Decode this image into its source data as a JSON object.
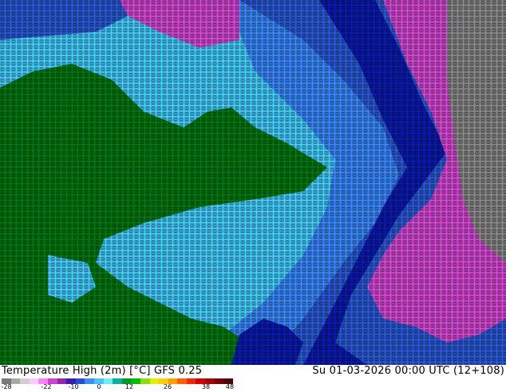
{
  "title": "Temperature High (2m) [°C] GFS 0.25",
  "datetime": "Su 01-03-2026 00:00 UTC (12+108)",
  "colorbar": {
    "colors": [
      "#7a7a7a",
      "#a8a8a8",
      "#d0d0d0",
      "#ffc6ff",
      "#ff80ff",
      "#d040d0",
      "#9a20b0",
      "#3a1ab8",
      "#2a4ad8",
      "#3a8aff",
      "#46c4ff",
      "#6af0f0",
      "#00b4a0",
      "#009a28",
      "#00c000",
      "#8ae000",
      "#e4f000",
      "#ffd000",
      "#ffa000",
      "#ff6000",
      "#ff2000",
      "#d80000",
      "#a80000",
      "#780000",
      "#500000"
    ],
    "ticks": [
      "-28",
      "-22",
      "-10",
      "0",
      "12",
      "26",
      "38",
      "48"
    ]
  },
  "map_colors": {
    "deep_blue": "#0a1ab0",
    "mid_blue": "#2a5ad8",
    "light_blue": "#3a8aff",
    "cyan": "#46d0ff",
    "green": "#007a10",
    "dark_green": "#006a0c",
    "magenta": "#d64ad6",
    "grey": "#8a8a8a"
  }
}
